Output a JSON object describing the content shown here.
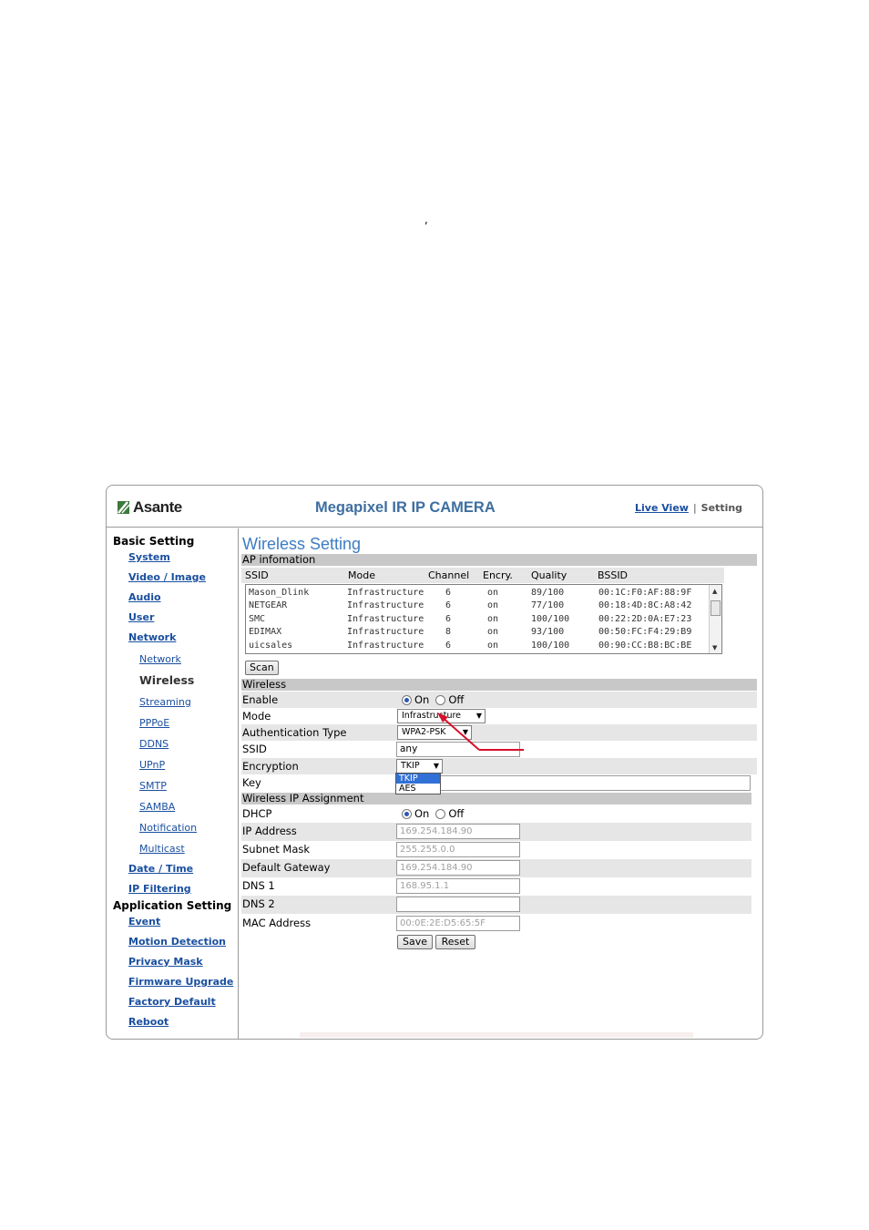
{
  "stray_mark": ",",
  "header": {
    "logo_text": "Asante",
    "camera_title": "Megapixel IR IP CAMERA",
    "nav_live_view": "Live View",
    "nav_separator": "|",
    "nav_setting": "Setting"
  },
  "sidebar": {
    "basic_heading": "Basic Setting",
    "system": "System",
    "video_image": "Video / Image",
    "audio": "Audio",
    "user": "User",
    "network": "Network",
    "network_sub": {
      "network": "Network",
      "wireless": "Wireless",
      "streaming": "Streaming",
      "pppoe": "PPPoE",
      "ddns": "DDNS",
      "upnp": "UPnP",
      "smtp": "SMTP",
      "samba": "SAMBA",
      "notification": "Notification",
      "multicast": "Multicast"
    },
    "date_time": "Date / Time",
    "ip_filtering": "IP Filtering",
    "application_heading": "Application Setting",
    "event": "Event",
    "motion_detection": "Motion Detection",
    "privacy_mask": "Privacy Mask",
    "firmware_upgrade": "Firmware Upgrade",
    "factory_default": "Factory Default",
    "reboot": "Reboot"
  },
  "main": {
    "title": "Wireless Setting",
    "ap_section": "AP infomation",
    "ap_columns": [
      "SSID",
      "Mode",
      "Channel",
      "Encry.",
      "Quality",
      "BSSID"
    ],
    "ap_rows": [
      [
        "Mason_Dlink",
        "Infrastructure",
        "6",
        "on",
        "89/100",
        "00:1C:F0:AF:88:9F"
      ],
      [
        "NETGEAR",
        "Infrastructure",
        "6",
        "on",
        "77/100",
        "00:18:4D:8C:A8:42"
      ],
      [
        "SMC",
        "Infrastructure",
        "6",
        "on",
        "100/100",
        "00:22:2D:0A:E7:23"
      ],
      [
        "EDIMAX",
        "Infrastructure",
        "8",
        "on",
        "93/100",
        "00:50:FC:F4:29:B9"
      ],
      [
        "uicsales",
        "Infrastructure",
        "6",
        "on",
        "100/100",
        "00:90:CC:B8:BC:BE"
      ]
    ],
    "scan_button": "Scan",
    "wireless_section": "Wireless",
    "enable_label": "Enable",
    "on_label": "On",
    "off_label": "Off",
    "mode_label": "Mode",
    "mode_value": "Infrastructure",
    "auth_label": "Authentication Type",
    "auth_value": "WPA2-PSK",
    "ssid_label": "SSID",
    "ssid_value": "any",
    "encryption_label": "Encryption",
    "encryption_value": "TKIP",
    "encryption_options": [
      "TKIP",
      "AES"
    ],
    "key_label": "Key",
    "ip_section": "Wireless IP Assignment",
    "dhcp_label": "DHCP",
    "ip_label": "IP Address",
    "ip_value": "169.254.184.90",
    "subnet_label": "Subnet Mask",
    "subnet_value": "255.255.0.0",
    "gateway_label": "Default Gateway",
    "gateway_value": "169.254.184.90",
    "dns1_label": "DNS 1",
    "dns1_value": "168.95.1.1",
    "dns2_label": "DNS 2",
    "mac_label": "MAC Address",
    "mac_value": "00:0E:2E:D5:65:5F",
    "save_button": "Save",
    "reset_button": "Reset"
  },
  "colors": {
    "title_blue": "#3e7cc2",
    "link_blue": "#1a4fa0",
    "section_gray": "#c8c8c8",
    "annotation_red": "#d8102a"
  }
}
